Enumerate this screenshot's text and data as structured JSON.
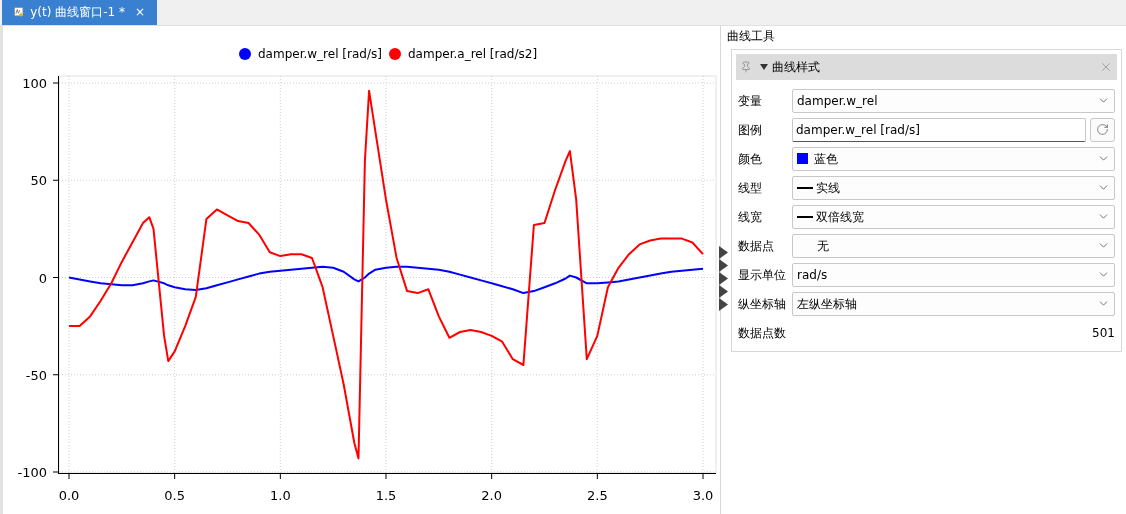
{
  "tab": {
    "title": "y(t) 曲线窗口-1 *",
    "close": "×",
    "selected": true
  },
  "chart": {
    "chart_data": {
      "type": "line",
      "grid": true,
      "legend": true,
      "xlim": [
        0,
        3
      ],
      "ylim": [
        -100,
        100
      ],
      "xticks": [
        {
          "value": 0,
          "label": "0.0"
        },
        {
          "value": 0.5,
          "label": "0.5"
        },
        {
          "value": 1,
          "label": "1.0"
        },
        {
          "value": 1.5,
          "label": "1.5"
        },
        {
          "value": 2,
          "label": "2.0"
        },
        {
          "value": 2.5,
          "label": "2.5"
        },
        {
          "value": 3,
          "label": "3.0"
        }
      ],
      "yticks": [
        100,
        50,
        0,
        -50,
        -100
      ],
      "x": [
        0,
        0.05,
        0.1,
        0.15,
        0.2,
        0.25,
        0.3,
        0.35,
        0.38,
        0.4,
        0.45,
        0.47,
        0.5,
        0.55,
        0.6,
        0.65,
        0.7,
        0.75,
        0.8,
        0.85,
        0.9,
        0.95,
        1.0,
        1.05,
        1.1,
        1.15,
        1.2,
        1.25,
        1.3,
        1.35,
        1.37,
        1.4,
        1.42,
        1.45,
        1.5,
        1.55,
        1.6,
        1.65,
        1.7,
        1.75,
        1.8,
        1.85,
        1.9,
        1.95,
        2.0,
        2.05,
        2.1,
        2.15,
        2.2,
        2.25,
        2.3,
        2.35,
        2.37,
        2.4,
        2.45,
        2.5,
        2.55,
        2.6,
        2.65,
        2.7,
        2.75,
        2.8,
        2.85,
        2.9,
        2.95,
        3.0
      ],
      "series": [
        {
          "name": "damper.w_rel [rad/s]",
          "color": "#0000ff",
          "values": [
            0,
            -1,
            -2,
            -3,
            -3.5,
            -4,
            -4,
            -3,
            -2,
            -1.5,
            -3,
            -4,
            -5,
            -6,
            -6.5,
            -5.5,
            -4,
            -2.5,
            -1,
            0.5,
            2,
            3,
            3.5,
            4,
            4.5,
            5,
            5.5,
            5,
            3,
            -1,
            -2,
            0,
            2,
            4,
            5,
            5.5,
            5.5,
            5,
            4.5,
            4,
            3,
            1.5,
            0,
            -1.5,
            -3,
            -4.5,
            -6,
            -8,
            -7,
            -5,
            -3,
            -0.5,
            1,
            0,
            -3,
            -3,
            -2.5,
            -2,
            -1,
            0,
            1,
            2,
            3,
            3.5,
            4,
            4.5
          ]
        },
        {
          "name": "damper.a_rel [rad/s2]",
          "color": "#ff0000",
          "values": [
            -25,
            -25,
            -20,
            -12,
            -3,
            8,
            18,
            28,
            31,
            25,
            -30,
            -43,
            -38,
            -25,
            -10,
            30,
            35,
            32,
            29,
            28,
            22,
            13,
            11,
            12,
            12,
            10,
            -5,
            -30,
            -55,
            -85,
            -93,
            60,
            96,
            75,
            40,
            10,
            -7,
            -8,
            -6,
            -20,
            -31,
            -28,
            -27,
            -28,
            -30,
            -33,
            -42,
            -45,
            27,
            28,
            45,
            60,
            65,
            40,
            -42,
            -30,
            -5,
            5,
            12,
            17,
            19,
            20,
            20,
            20,
            18,
            12
          ]
        }
      ]
    }
  },
  "panel": {
    "title": "曲线工具",
    "section": {
      "title": "曲线样式",
      "expanded": true,
      "rows": [
        {
          "kind": "combo",
          "label": "变量",
          "value": "damper.w_rel"
        },
        {
          "kind": "text",
          "label": "图例",
          "value": "damper.w_rel [rad/s]"
        },
        {
          "kind": "color",
          "label": "颜色",
          "value": "蓝色",
          "color": "#0000ff"
        },
        {
          "kind": "line",
          "label": "线型",
          "value": "实线"
        },
        {
          "kind": "line",
          "label": "线宽",
          "value": "双倍线宽"
        },
        {
          "kind": "marker",
          "label": "数据点",
          "value": "无"
        },
        {
          "kind": "combo",
          "label": "显示单位",
          "value": "rad/s"
        },
        {
          "kind": "combo",
          "label": "纵坐标轴",
          "value": "左纵坐标轴"
        },
        {
          "kind": "value",
          "label": "数据点数",
          "value": "501"
        }
      ]
    }
  }
}
